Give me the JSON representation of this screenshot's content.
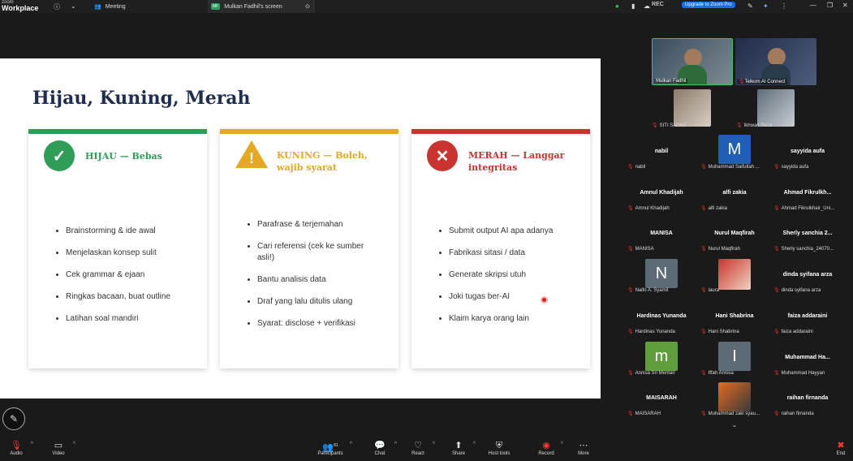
{
  "topbar": {
    "brand_line1": "zoom",
    "brand_line2": "Workplace",
    "tab_meeting": "Meeting",
    "tab_screen_badge": "MF",
    "tab_screen": "Mulkan Fadhil's screen",
    "rec": "REC",
    "upgrade": "Upgrade to Zoom Pro"
  },
  "slide": {
    "title": "Hijau, Kuning, Merah",
    "cards": [
      {
        "title_line1": "HIJAU — Bebas",
        "title_line2": "",
        "color": "#2e9e57",
        "icon": "check-circle-icon",
        "items": [
          "Brainstorming & ide awal",
          "Menjelaskan konsep sulit",
          "Cek grammar & ejaan",
          "Ringkas bacaan, buat outline",
          "Latihan soal mandiri"
        ]
      },
      {
        "title_line1": "KUNING — Boleh,",
        "title_line2": "wajib syarat",
        "color": "#e5a823",
        "icon": "warning-triangle-icon",
        "items": [
          "Parafrase & terjemahan",
          "Cari referensi (cek ke sumber",
          "asli!)",
          "Bantu analisis data",
          "Draf yang lalu ditulis ulang",
          "Syarat: disclose + verifikasi"
        ]
      },
      {
        "title_line1": "MERAH — Langgar",
        "title_line2": "integritas",
        "color": "#c9342e",
        "icon": "x-circle-icon",
        "items": [
          "Submit output AI apa adanya",
          "Fabrikasi sitasi / data",
          "Generate skripsi utuh",
          "Joki tugas ber-AI",
          "Klaim karya orang lain"
        ]
      }
    ]
  },
  "gallery": {
    "videos": [
      {
        "name": "Mulkan Fadhil"
      },
      {
        "name": "Telkom AI Connect"
      },
      {
        "name": "SITI SALWA"
      },
      {
        "name": "Ikhwan Reza"
      }
    ],
    "participants": [
      {
        "title": "nabil",
        "label": "nabil"
      },
      {
        "avatar": "M",
        "label": "Muhammad Saifullah ..."
      },
      {
        "title": "sayyida aufa",
        "label": "sayyida aufa"
      },
      {
        "title": "Amnul Khadijah",
        "label": "Amnul Khadijah"
      },
      {
        "title": "alfi zakia",
        "label": "alfi zakia"
      },
      {
        "title": "Ahmad Fikrulkh...",
        "label": "Ahmad Fikrulkhair_Uni..."
      },
      {
        "title": "MANISA",
        "label": "MANISA"
      },
      {
        "title": "Nurul Maqfirah",
        "label": "Nurul Maqfirah"
      },
      {
        "title": "Sherly sanchia 2...",
        "label": "Sherly sanchia_24070..."
      },
      {
        "avatar": "N",
        "label": "Naifo A. Syamil"
      },
      {
        "label": "laura"
      },
      {
        "title": "dinda syifana arza",
        "label": "dinda syifana arza"
      },
      {
        "title": "Hardinas Yunanda",
        "label": "Hardinas Yunanda"
      },
      {
        "title": "Hani Shabrina",
        "label": "Hani Shabrina"
      },
      {
        "title": "faiza addaraini",
        "label": "faiza addaraini"
      },
      {
        "avatar": "m",
        "label": "Annisa Sri Mentari"
      },
      {
        "avatar": "I",
        "label": "Iffah Annisa"
      },
      {
        "title": "Muhammad Ha...",
        "label": "Muhammad Hayyan"
      },
      {
        "title": "MAISARAH",
        "label": "MAISARAH"
      },
      {
        "label": "Muhammad zaki syau..."
      },
      {
        "title": "raihan firnanda",
        "label": "raihan firnanda"
      }
    ]
  },
  "toolbar": {
    "audio": "Audio",
    "video": "Video",
    "participants": "Participants",
    "participants_count": "81",
    "chat": "Chat",
    "react": "React",
    "share": "Share",
    "host_tools": "Host tools",
    "record": "Record",
    "more": "More",
    "end": "End"
  },
  "colors": {
    "green": "#2e9e57",
    "yellow": "#e5a823",
    "red": "#c9342e",
    "title": "#1f2d4f"
  }
}
